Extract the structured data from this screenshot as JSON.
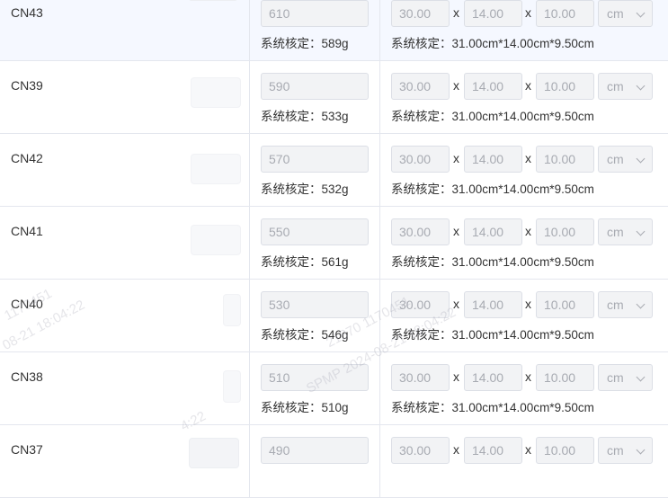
{
  "rows": [
    {
      "size": "CN43",
      "weight": "610",
      "weight_note": "系统核定：589g",
      "length": "30.00",
      "width": "14.00",
      "height": "10.00",
      "unit": "cm",
      "dim_note": "系统核定：31.00cm*14.00cm*9.50cm"
    },
    {
      "size": "CN39",
      "weight": "590",
      "weight_note": "系统核定：533g",
      "length": "30.00",
      "width": "14.00",
      "height": "10.00",
      "unit": "cm",
      "dim_note": "系统核定：31.00cm*14.00cm*9.50cm"
    },
    {
      "size": "CN42",
      "weight": "570",
      "weight_note": "系统核定：532g",
      "length": "30.00",
      "width": "14.00",
      "height": "10.00",
      "unit": "cm",
      "dim_note": "系统核定：31.00cm*14.00cm*9.50cm"
    },
    {
      "size": "CN41",
      "weight": "550",
      "weight_note": "系统核定：561g",
      "length": "30.00",
      "width": "14.00",
      "height": "10.00",
      "unit": "cm",
      "dim_note": "系统核定：31.00cm*14.00cm*9.50cm"
    },
    {
      "size": "CN40",
      "weight": "530",
      "weight_note": "系统核定：546g",
      "length": "30.00",
      "width": "14.00",
      "height": "10.00",
      "unit": "cm",
      "dim_note": "系统核定：31.00cm*14.00cm*9.50cm"
    },
    {
      "size": "CN38",
      "weight": "510",
      "weight_note": "系统核定：510g",
      "length": "30.00",
      "width": "14.00",
      "height": "10.00",
      "unit": "cm",
      "dim_note": "系统核定：31.00cm*14.00cm*9.50cm"
    },
    {
      "size": "CN37",
      "weight": "490",
      "weight_note": "",
      "length": "30.00",
      "width": "14.00",
      "height": "10.00",
      "unit": "cm",
      "dim_note": ""
    }
  ],
  "dim_separator": "x",
  "watermarks": [
    "1170451",
    "08-21 18:04:22",
    "21870 1170451",
    "SPMP 2024-08-21 18:04:22",
    "4:22"
  ]
}
